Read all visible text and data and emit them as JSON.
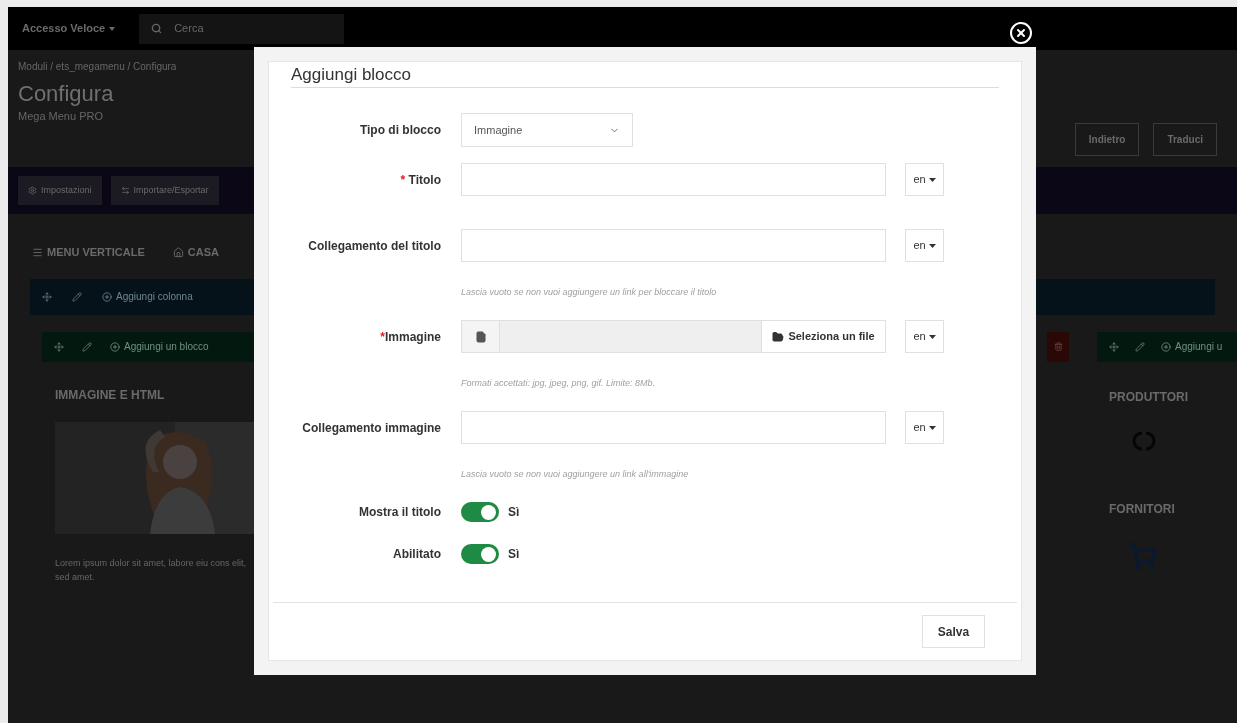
{
  "background": {
    "top_bar": {
      "quick_access": "Accesso Veloce",
      "search_placeholder": "Cerca"
    },
    "breadcrumb": "Moduli / ets_megamenu / Configura",
    "title": "Configura",
    "subtitle": "Mega Menu PRO",
    "header_buttons": [
      "Indietro",
      "Traduci"
    ],
    "toolbar_buttons": [
      "Impostazioni",
      "Importare/Esportar"
    ],
    "menu_tabs": [
      "MENU VERTICALE",
      "CASA"
    ],
    "column_bar": {
      "label": "Aggiungi colonna"
    },
    "left_column": {
      "bar_label": "Aggiungi un blocco",
      "block_title": "IMMAGINE E HTML",
      "block_text": "Lorem ipsum dolor sit amet, labore eiu cons elit, sed amet."
    },
    "right_column": {
      "bar_label": "Aggiungi u",
      "blocks": [
        "PRODUTTORI",
        "FORNITORI"
      ]
    }
  },
  "modal": {
    "title": "Aggiungi blocco",
    "fields": [
      {
        "kind": "select",
        "label": "Tipo di blocco",
        "value": "Immagine"
      },
      {
        "kind": "text",
        "label": "Titolo",
        "required_mark": "*",
        "lang": "en"
      },
      {
        "kind": "text",
        "label": "Collegamento del titolo",
        "lang": "en",
        "hint": "Lascia vuoto se non vuoi aggiungere un link per bloccare il titolo"
      },
      {
        "kind": "file",
        "label": "Immagine",
        "required_mark": "*",
        "button": "Seleziona un file",
        "lang": "en",
        "hint": "Formati accettati: jpg, jpeg, png, gif. Limite: 8Mb."
      },
      {
        "kind": "text",
        "label": "Collegamento immagine",
        "lang": "en",
        "hint": "Lascia vuoto se non vuoi aggiungere un link all'immagine"
      },
      {
        "kind": "toggle",
        "label": "Mostra il titolo",
        "on": true,
        "text": "Sì"
      },
      {
        "kind": "toggle",
        "label": "Abilitato",
        "on": true,
        "text": "Sì"
      }
    ],
    "save_button": "Salva"
  }
}
